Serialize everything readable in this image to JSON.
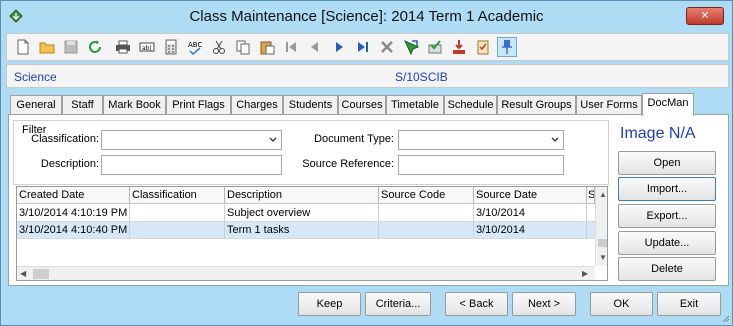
{
  "window": {
    "title": "Class Maintenance  [Science]:  2014 Term 1 Academic",
    "close_label": "✕"
  },
  "toolbar": {
    "icons": [
      "new-document-icon",
      "open-folder-icon",
      "save-icon",
      "refresh-icon",
      "print-icon",
      "field-icon",
      "calculator-icon",
      "spell-check-icon",
      "cut-icon",
      "copy-icon",
      "paste-icon",
      "first-record-icon",
      "previous-record-icon",
      "next-record-icon",
      "last-record-icon",
      "delete-icon",
      "pointer-icon",
      "approve-icon",
      "download-icon",
      "checklist-icon",
      "pin-icon"
    ]
  },
  "context": {
    "department": "Science",
    "class_code": "S/10SCIB"
  },
  "tabs": [
    "General",
    "Staff",
    "Mark Book",
    "Print Flags",
    "Charges",
    "Students",
    "Courses",
    "Timetable",
    "Schedule",
    "Result Groups",
    "User Forms",
    "DocMan"
  ],
  "active_tab": "DocMan",
  "filter": {
    "legend": "Filter",
    "classification_label": "Classification:",
    "classification_value": "",
    "document_type_label": "Document Type:",
    "document_type_value": "",
    "description_label": "Description:",
    "description_value": "",
    "source_reference_label": "Source Reference:",
    "source_reference_value": ""
  },
  "image_label": "Image N/A",
  "side_buttons": {
    "open": "Open",
    "import": "Import...",
    "export": "Export...",
    "update": "Update...",
    "delete": "Delete"
  },
  "grid": {
    "columns": [
      "Created Date",
      "Classification",
      "Description",
      "Source Code",
      "Source Date",
      "S"
    ],
    "rows": [
      {
        "created_date": "3/10/2014 4:10:19 PM",
        "classification": "",
        "description": "Subject overview",
        "source_code": "",
        "source_date": "3/10/2014"
      },
      {
        "created_date": "3/10/2014 4:10:40 PM",
        "classification": "",
        "description": "Term 1 tasks",
        "source_code": "",
        "source_date": "3/10/2014"
      }
    ]
  },
  "bottom_buttons": {
    "keep": "Keep",
    "criteria": "Criteria...",
    "back": "< Back",
    "next": "Next >",
    "ok": "OK",
    "exit": "Exit"
  }
}
